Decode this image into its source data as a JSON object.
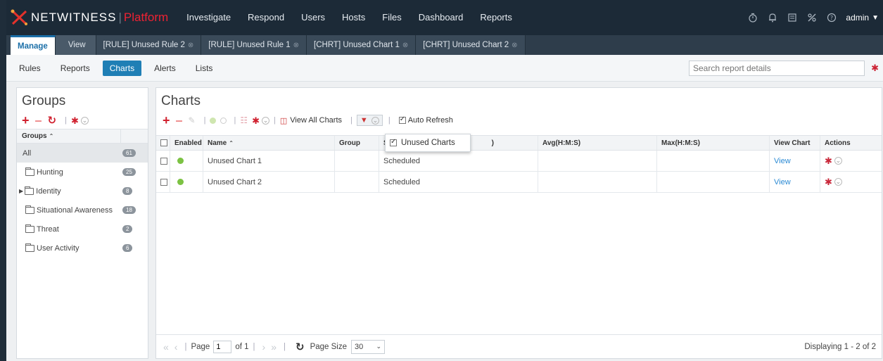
{
  "brand": {
    "name": "NETWITNESS",
    "separator": "|",
    "platform": "Platform",
    "accent_color": "#e22233"
  },
  "nav": {
    "items": [
      "Investigate",
      "Respond",
      "Users",
      "Hosts",
      "Files",
      "Dashboard",
      "Reports"
    ],
    "user": "admin"
  },
  "tabs": {
    "manage": "Manage",
    "view": "View",
    "open": [
      "[RULE] Unused Rule 2",
      "[RULE] Unused Rule 1",
      "[CHRT] Unused Chart 1",
      "[CHRT] Unused Chart 2"
    ]
  },
  "subnav": {
    "items": [
      "Rules",
      "Reports",
      "Charts",
      "Alerts",
      "Lists"
    ],
    "active": "Charts",
    "search_placeholder": "Search report details"
  },
  "groups": {
    "title": "Groups",
    "header": "Groups",
    "rows": [
      {
        "label": "All",
        "count": "61"
      },
      {
        "label": "Hunting",
        "count": "25"
      },
      {
        "label": "Identity",
        "count": "8"
      },
      {
        "label": "Situational Awareness",
        "count": "18"
      },
      {
        "label": "Threat",
        "count": "2"
      },
      {
        "label": "User Activity",
        "count": "6"
      }
    ]
  },
  "charts": {
    "title": "Charts",
    "toolbar": {
      "view_all": "View All Charts",
      "auto_refresh": "Auto Refresh"
    },
    "filter_dropdown": {
      "option": "Unused Charts",
      "checked": true
    },
    "columns": [
      "Enabled",
      "Name",
      "Group",
      "S",
      ")",
      "Avg(H:M:S)",
      "Max(H:M:S)",
      "View Chart",
      "Actions"
    ],
    "rows": [
      {
        "name": "Unused Chart 1",
        "status": "Scheduled",
        "view": "View"
      },
      {
        "name": "Unused Chart 2",
        "status": "Scheduled",
        "view": "View"
      }
    ]
  },
  "pager": {
    "page_label": "Page",
    "page": "1",
    "of": "of 1",
    "page_size_label": "Page Size",
    "page_size": "30",
    "display": "Displaying 1 - 2 of 2"
  }
}
